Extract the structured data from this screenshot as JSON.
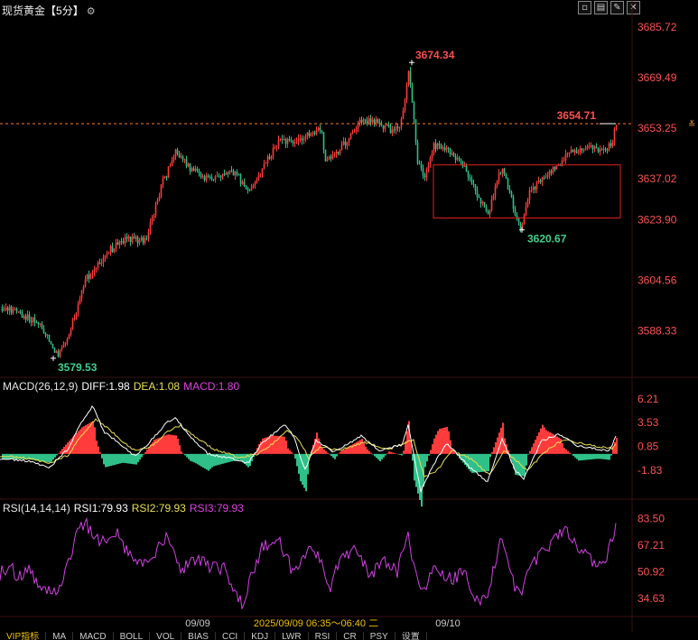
{
  "header": {
    "title": "现货黄金",
    "period": "【5分】",
    "settings_icon": "gear-icon",
    "window_buttons": [
      {
        "name": "restore-icon",
        "glyph": "▫"
      },
      {
        "name": "layout-icon",
        "glyph": "▤"
      },
      {
        "name": "edit-icon",
        "glyph": "✎"
      },
      {
        "name": "close-icon",
        "glyph": "✕"
      }
    ]
  },
  "chart_data": [
    {
      "type": "candlestick",
      "panel": "price",
      "y_axis_labels": [
        "3685.72",
        "3669.49",
        "3653.25",
        "3637.02",
        "3623.90",
        "3604.56",
        "3588.33"
      ],
      "ylim": [
        3574,
        3688
      ],
      "current_price": 3654.71,
      "current_price_label": "3654.71",
      "annotations": [
        {
          "text": "3674.34",
          "value": 3674.34,
          "kind": "high"
        },
        {
          "text": "3579.53",
          "value": 3579.53,
          "kind": "low"
        },
        {
          "text": "3620.67",
          "value": 3620.67,
          "kind": "low"
        }
      ],
      "highlight_box": {
        "from_value": 3624.5,
        "to_value": 3641.5
      },
      "x_labels": [
        "09/09",
        "09/10"
      ],
      "cursor_label": "2025/09/09 06:35～06:40 二",
      "colors": {
        "up": "#ff3b3b",
        "down": "#2fc08a",
        "annotation_high": "#ff4b4b",
        "annotation_low": "#3fd08e",
        "box": "#e02020"
      },
      "trend_points": [
        [
          0,
          3596
        ],
        [
          20,
          3594
        ],
        [
          45,
          3590
        ],
        [
          63,
          3580.5
        ],
        [
          75,
          3587
        ],
        [
          95,
          3605
        ],
        [
          120,
          3614
        ],
        [
          140,
          3618
        ],
        [
          160,
          3617
        ],
        [
          180,
          3636
        ],
        [
          195,
          3646
        ],
        [
          210,
          3640
        ],
        [
          230,
          3637
        ],
        [
          260,
          3639
        ],
        [
          275,
          3633
        ],
        [
          290,
          3640
        ],
        [
          310,
          3650
        ],
        [
          325,
          3648
        ],
        [
          340,
          3651
        ],
        [
          355,
          3653
        ],
        [
          360,
          3643
        ],
        [
          370,
          3644
        ],
        [
          385,
          3650
        ],
        [
          400,
          3656
        ],
        [
          420,
          3655
        ],
        [
          435,
          3652
        ],
        [
          445,
          3656
        ],
        [
          452,
          3671
        ],
        [
          457,
          3660
        ],
        [
          462,
          3642
        ],
        [
          470,
          3637
        ],
        [
          480,
          3648
        ],
        [
          500,
          3645
        ],
        [
          515,
          3640
        ],
        [
          525,
          3634
        ],
        [
          540,
          3626
        ],
        [
          555,
          3641
        ],
        [
          565,
          3631
        ],
        [
          576,
          3621
        ],
        [
          585,
          3632
        ],
        [
          600,
          3637
        ],
        [
          615,
          3641
        ],
        [
          630,
          3645
        ],
        [
          650,
          3647
        ],
        [
          665,
          3646
        ],
        [
          677,
          3648
        ],
        [
          682,
          3654.7
        ]
      ]
    },
    {
      "type": "bar",
      "panel": "macd",
      "y_axis_labels": [
        "6.21",
        "3.53",
        "0.85",
        "-1.83"
      ],
      "ylim": [
        -5,
        7
      ],
      "legend": {
        "name": "MACD(26,12,9)",
        "diff": "DIFF:1.98",
        "dea": "DEA:1.08",
        "macd": "MACD:1.80"
      },
      "colors": {
        "pos": "#ff3b3b",
        "neg": "#2fc08a",
        "diff": "#ffffff",
        "dea": "#e8e050",
        "macd_text": "#e040e0"
      },
      "diff_points": [
        [
          0,
          -0.5
        ],
        [
          30,
          -0.8
        ],
        [
          55,
          -1.5
        ],
        [
          75,
          0.5
        ],
        [
          90,
          3.5
        ],
        [
          103,
          5.5
        ],
        [
          115,
          2.5
        ],
        [
          135,
          1
        ],
        [
          150,
          -0.3
        ],
        [
          170,
          1.8
        ],
        [
          185,
          3.6
        ],
        [
          195,
          4
        ],
        [
          210,
          2
        ],
        [
          230,
          0
        ],
        [
          260,
          -0.6
        ],
        [
          275,
          -1
        ],
        [
          290,
          1.2
        ],
        [
          315,
          3.3
        ],
        [
          325,
          2
        ],
        [
          338,
          -1.8
        ],
        [
          350,
          1.5
        ],
        [
          370,
          0.2
        ],
        [
          400,
          2
        ],
        [
          420,
          0.4
        ],
        [
          445,
          1
        ],
        [
          452,
          3.2
        ],
        [
          458,
          0
        ],
        [
          466,
          -4.2
        ],
        [
          480,
          -1.2
        ],
        [
          495,
          1.2
        ],
        [
          520,
          -1.5
        ],
        [
          540,
          -3.2
        ],
        [
          556,
          1.8
        ],
        [
          570,
          -1.8
        ],
        [
          580,
          -2.8
        ],
        [
          600,
          1.5
        ],
        [
          620,
          2.2
        ],
        [
          640,
          0.9
        ],
        [
          660,
          0.6
        ],
        [
          675,
          0.3
        ],
        [
          682,
          1.98
        ]
      ],
      "dea_points": [
        [
          0,
          -0.2
        ],
        [
          30,
          -0.5
        ],
        [
          55,
          -1.0
        ],
        [
          75,
          -0.2
        ],
        [
          90,
          2.0
        ],
        [
          106,
          4.0
        ],
        [
          118,
          3.0
        ],
        [
          135,
          1.5
        ],
        [
          150,
          0.3
        ],
        [
          170,
          1.0
        ],
        [
          185,
          2.5
        ],
        [
          200,
          3.2
        ],
        [
          215,
          2.0
        ],
        [
          235,
          0.6
        ],
        [
          265,
          -0.4
        ],
        [
          285,
          0
        ],
        [
          300,
          1
        ],
        [
          318,
          2.6
        ],
        [
          332,
          1.5
        ],
        [
          342,
          -0.5
        ],
        [
          355,
          0.8
        ],
        [
          375,
          0.4
        ],
        [
          405,
          1.3
        ],
        [
          430,
          0.5
        ],
        [
          450,
          1.3
        ],
        [
          458,
          1.5
        ],
        [
          470,
          -2.6
        ],
        [
          485,
          -1.8
        ],
        [
          500,
          0.4
        ],
        [
          522,
          -0.6
        ],
        [
          542,
          -2.4
        ],
        [
          558,
          0.4
        ],
        [
          572,
          -0.8
        ],
        [
          584,
          -1.9
        ],
        [
          604,
          0.3
        ],
        [
          624,
          1.6
        ],
        [
          644,
          1.2
        ],
        [
          664,
          0.8
        ],
        [
          678,
          0.6
        ],
        [
          682,
          1.08
        ]
      ]
    },
    {
      "type": "line",
      "panel": "rsi",
      "y_axis_labels": [
        "83.50",
        "67.21",
        "50.92",
        "34.63"
      ],
      "ylim": [
        24,
        86
      ],
      "legend": {
        "name": "RSI(14,14,14)",
        "rsi1": "RSI1:79.93",
        "rsi2": "RSI2:79.93",
        "rsi3": "RSI3:79.93"
      },
      "colors": {
        "rsi1": "#ffffff",
        "rsi2": "#e8e050",
        "rsi3": "#e040e0",
        "line": "#d040e0"
      },
      "rsi_points": [
        [
          0,
          50
        ],
        [
          10,
          55
        ],
        [
          20,
          48
        ],
        [
          30,
          52
        ],
        [
          45,
          44
        ],
        [
          60,
          38
        ],
        [
          70,
          45
        ],
        [
          78,
          62
        ],
        [
          85,
          76
        ],
        [
          95,
          80
        ],
        [
          105,
          72
        ],
        [
          115,
          70
        ],
        [
          130,
          74
        ],
        [
          145,
          60
        ],
        [
          160,
          55
        ],
        [
          175,
          66
        ],
        [
          185,
          72
        ],
        [
          200,
          52
        ],
        [
          215,
          60
        ],
        [
          230,
          54
        ],
        [
          250,
          52
        ],
        [
          268,
          32
        ],
        [
          278,
          48
        ],
        [
          290,
          66
        ],
        [
          310,
          68
        ],
        [
          325,
          50
        ],
        [
          340,
          64
        ],
        [
          355,
          58
        ],
        [
          365,
          40
        ],
        [
          375,
          56
        ],
        [
          395,
          66
        ],
        [
          410,
          48
        ],
        [
          425,
          58
        ],
        [
          440,
          50
        ],
        [
          452,
          74
        ],
        [
          458,
          54
        ],
        [
          466,
          36
        ],
        [
          480,
          52
        ],
        [
          500,
          46
        ],
        [
          515,
          52
        ],
        [
          525,
          30
        ],
        [
          540,
          38
        ],
        [
          555,
          70
        ],
        [
          565,
          48
        ],
        [
          575,
          36
        ],
        [
          590,
          56
        ],
        [
          610,
          68
        ],
        [
          625,
          78
        ],
        [
          640,
          64
        ],
        [
          660,
          56
        ],
        [
          672,
          60
        ],
        [
          682,
          79.93
        ]
      ]
    }
  ],
  "bottom_tabs": [
    "VIP指标",
    "MA",
    "MACD",
    "BOLL",
    "VOL",
    "BIAS",
    "CCI",
    "KDJ",
    "LWR",
    "RSI",
    "CR",
    "PSY",
    "设置"
  ]
}
